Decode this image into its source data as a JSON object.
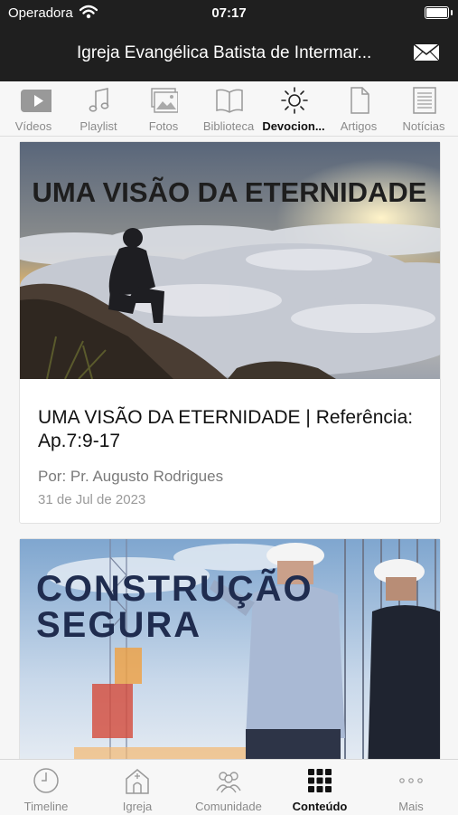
{
  "status": {
    "carrier": "Operadora",
    "time": "07:17"
  },
  "header": {
    "title": "Igreja Evangélica Batista de Intermar..."
  },
  "tabs": [
    {
      "label": "Vídeos",
      "icon": "video-icon"
    },
    {
      "label": "Playlist",
      "icon": "music-note-icon"
    },
    {
      "label": "Fotos",
      "icon": "photos-icon"
    },
    {
      "label": "Biblioteca",
      "icon": "book-icon"
    },
    {
      "label": "Devocion...",
      "icon": "sun-icon"
    },
    {
      "label": "Artigos",
      "icon": "document-icon"
    },
    {
      "label": "Notícias",
      "icon": "newspaper-icon"
    }
  ],
  "posts": [
    {
      "image_title": "UMA VISÃO DA ETERNIDADE",
      "title": "UMA VISÃO DA ETERNIDADE | Referência: Ap.7:9-17",
      "author": "Por: Pr. Augusto Rodrigues",
      "date": "31 de Jul de 2023"
    },
    {
      "image_title_line1": "CONSTRUÇÃO",
      "image_title_line2": "SEGURA"
    }
  ],
  "bottom_nav": [
    {
      "label": "Timeline",
      "icon": "clock-icon"
    },
    {
      "label": "Igreja",
      "icon": "church-icon"
    },
    {
      "label": "Comunidade",
      "icon": "people-icon"
    },
    {
      "label": "Conteúdo",
      "icon": "grid-icon"
    },
    {
      "label": "Mais",
      "icon": "more-icon"
    }
  ],
  "colors": {
    "header_bg": "#1f1f1f",
    "active": "#111111",
    "inactive": "#8a8a8a"
  }
}
